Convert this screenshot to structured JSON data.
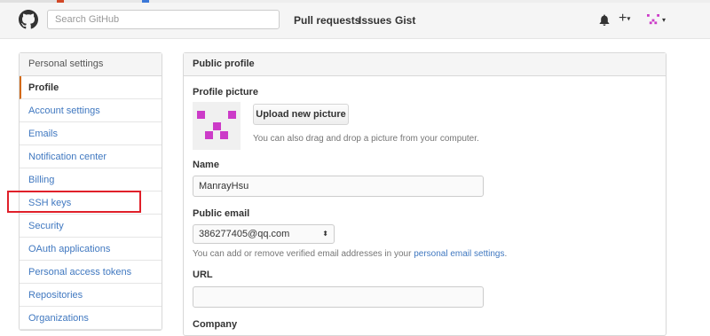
{
  "header": {
    "search_placeholder": "Search GitHub",
    "nav": [
      "Pull requests",
      "Issues",
      "Gist"
    ],
    "icons": [
      "github-logo-icon",
      "bell-icon",
      "plus-icon",
      "avatar-icon"
    ],
    "plus_label": "+",
    "caret": "▾"
  },
  "sidebar": {
    "heading": "Personal settings",
    "items": [
      {
        "label": "Profile",
        "active": true
      },
      {
        "label": "Account settings"
      },
      {
        "label": "Emails"
      },
      {
        "label": "Notification center"
      },
      {
        "label": "Billing"
      },
      {
        "label": "SSH keys"
      },
      {
        "label": "Security"
      },
      {
        "label": "OAuth applications"
      },
      {
        "label": "Personal access tokens"
      },
      {
        "label": "Repositories"
      },
      {
        "label": "Organizations"
      }
    ]
  },
  "main": {
    "heading": "Public profile",
    "profile_picture_label": "Profile picture",
    "upload_button": "Upload new picture",
    "upload_hint": "You can also drag and drop a picture from your computer.",
    "name_label": "Name",
    "name_value": "ManrayHsu",
    "public_email_label": "Public email",
    "public_email_value": "386277405@qq.com",
    "select_arrow": "⬍",
    "email_hint_prefix": "You can add or remove verified email addresses in your ",
    "email_hint_link": "personal email settings",
    "email_hint_suffix": ".",
    "url_label": "URL",
    "url_value": "",
    "company_label": "Company"
  },
  "colors": {
    "link": "#4078c0",
    "avatar": "#cc3bc8",
    "active_border": "#d26911",
    "highlight": "#e0202a"
  }
}
